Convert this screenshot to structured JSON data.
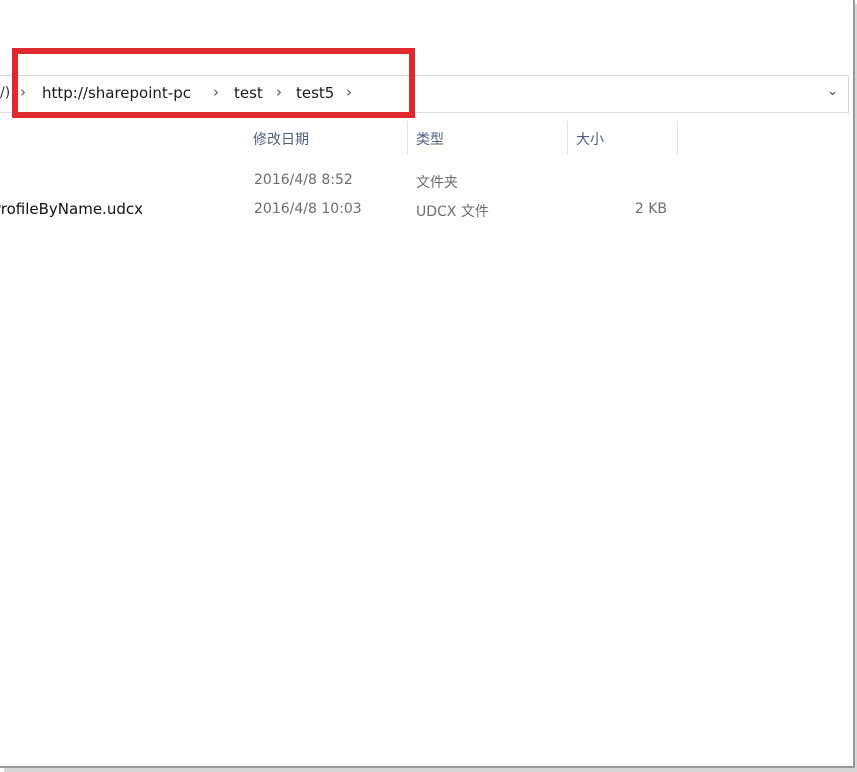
{
  "address_bar": {
    "leading_fragment": "/)",
    "crumbs": [
      "http://sharepoint-pc",
      "test",
      "test5"
    ],
    "separator": "›",
    "dropdown_glyph": "⌄"
  },
  "columns": {
    "modified": "修改日期",
    "type": "类型",
    "size": "大小"
  },
  "rows": [
    {
      "name": "",
      "modified": "2016/4/8 8:52",
      "type": "文件夹",
      "size": ""
    },
    {
      "name": "ProfileByName.udcx",
      "modified": "2016/4/8 10:03",
      "type": "UDCX 文件",
      "size": "2 KB"
    }
  ],
  "highlight_color": "#e0292f"
}
